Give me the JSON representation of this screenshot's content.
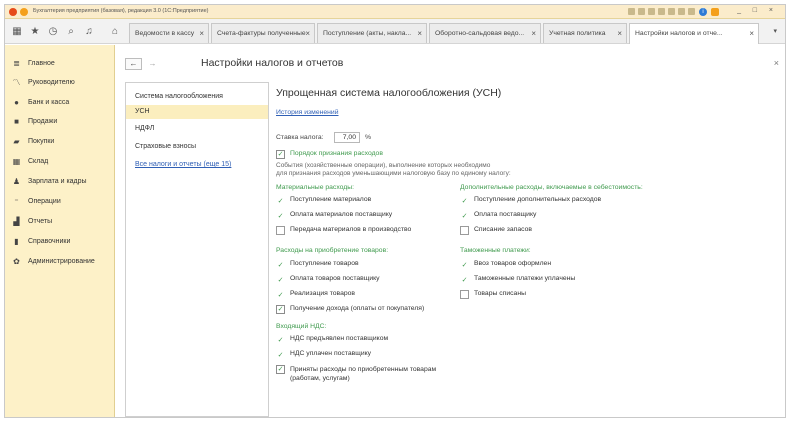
{
  "window": {
    "title": "Бухгалтерия предприятия (базовая), редакция 3.0  (1С:Предприятие)",
    "info_label": "i",
    "controls": [
      "_",
      "□",
      "×"
    ]
  },
  "tabs": [
    {
      "label": "Ведомости в кассу",
      "close": "×"
    },
    {
      "label": "Счета-фактуры полученные",
      "close": "×"
    },
    {
      "label": "Поступление (акты, накла...",
      "close": "×"
    },
    {
      "label": "Оборотно-сальдовая ведо...",
      "close": "×"
    },
    {
      "label": "Учетная политика",
      "close": "×"
    },
    {
      "label": "Настройки налогов и отче...",
      "close": "×"
    }
  ],
  "toolbar": {
    "more": "▾"
  },
  "sidebar": {
    "items": [
      {
        "label": "Главное",
        "icon": "menu-icon"
      },
      {
        "label": "Руководителю",
        "icon": "chart-line-icon"
      },
      {
        "label": "Банк и касса",
        "icon": "bank-icon"
      },
      {
        "label": "Продажи",
        "icon": "cart-icon"
      },
      {
        "label": "Покупки",
        "icon": "basket-icon"
      },
      {
        "label": "Склад",
        "icon": "warehouse-icon"
      },
      {
        "label": "Зарплата и кадры",
        "icon": "person-icon"
      },
      {
        "label": "Операции",
        "icon": "operations-icon"
      },
      {
        "label": "Отчеты",
        "icon": "reports-icon"
      },
      {
        "label": "Справочники",
        "icon": "book-icon"
      },
      {
        "label": "Администрирование",
        "icon": "gear-icon"
      }
    ]
  },
  "page": {
    "title": "Настройки налогов и отчетов",
    "back": "←",
    "forward": "→",
    "close": "×"
  },
  "list": {
    "items": [
      "Система налогообложения",
      "УСН",
      "НДФЛ",
      "Страховые взносы"
    ],
    "selected": "УСН",
    "more_link": "Все налоги и отчеты (еще 15)"
  },
  "content": {
    "title": "Упрощенная система налогообложения (УСН)",
    "history_link": "История изменений",
    "rate_label": "Ставка налога:",
    "rate_value": "7,00",
    "rate_unit": "%",
    "expense_order_label": "Порядок признания расходов",
    "note_line1": "События (хозяйственные операции), выполнение которых необходимо",
    "note_line2": "для признания расходов уменьшающими налоговую базу по единому налогу:",
    "sections": {
      "materials": {
        "title": "Материальные расходы:",
        "items": [
          {
            "label": "Поступление материалов",
            "state": "tick"
          },
          {
            "label": "Оплата материалов поставщику",
            "state": "tick"
          },
          {
            "label": "Передача материалов в производство",
            "state": "unchecked"
          }
        ]
      },
      "extra": {
        "title": "Дополнительные расходы, включаемые в себестоимость:",
        "items": [
          {
            "label": "Поступление дополнительных расходов",
            "state": "tick"
          },
          {
            "label": "Оплата поставщику",
            "state": "tick"
          },
          {
            "label": "Списание запасов",
            "state": "unchecked"
          }
        ]
      },
      "goods": {
        "title": "Расходы на приобретение товаров:",
        "items": [
          {
            "label": "Поступление товаров",
            "state": "tick"
          },
          {
            "label": "Оплата товаров поставщику",
            "state": "tick"
          },
          {
            "label": "Реализация товаров",
            "state": "tick"
          },
          {
            "label": "Получение дохода (оплаты от покупателя)",
            "state": "checked"
          }
        ]
      },
      "customs": {
        "title": "Таможенные платежи:",
        "items": [
          {
            "label": "Ввоз товаров оформлен",
            "state": "tick"
          },
          {
            "label": "Таможенные платежи уплачены",
            "state": "tick"
          },
          {
            "label": "Товары списаны",
            "state": "unchecked"
          }
        ]
      },
      "vat": {
        "title": "Входящий НДС:",
        "items": [
          {
            "label": "НДС предъявлен поставщиком",
            "state": "tick"
          },
          {
            "label": "НДС уплачен поставщику",
            "state": "tick"
          },
          {
            "label": "Приняты расходы по приобретенным товарам",
            "label2": "(работам, услугам)",
            "state": "checked"
          }
        ]
      }
    }
  },
  "colors": {
    "sidebar_bg": "#fdf1c8",
    "titlebar_bg": "#fbeccb",
    "selected_bg": "#fbeebe",
    "section_green": "#3f9a4d",
    "link_blue": "#2f5fb5"
  }
}
